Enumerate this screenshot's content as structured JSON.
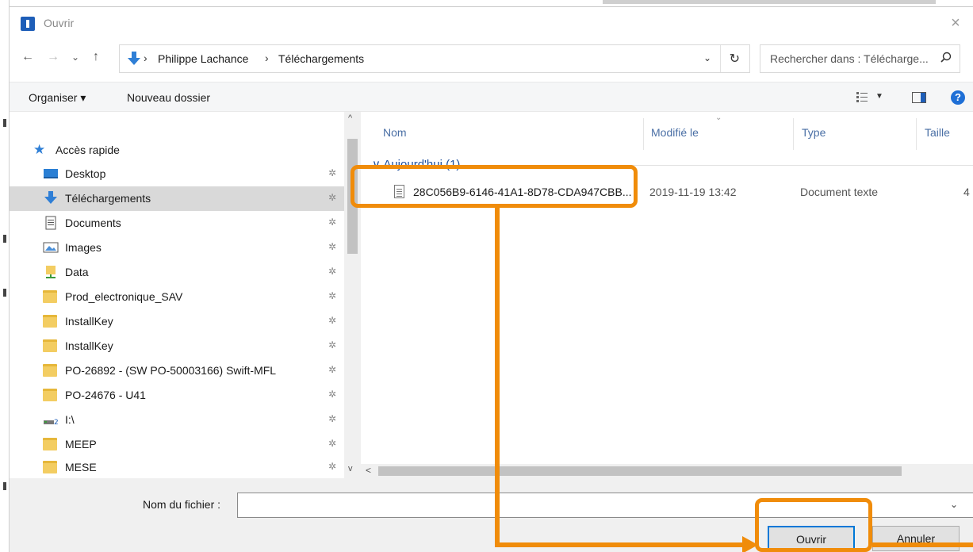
{
  "window": {
    "title": "Ouvrir",
    "close_glyph": "×"
  },
  "nav": {
    "back_glyph": "←",
    "forward_glyph": "→",
    "recent_glyph": "⌄",
    "up_glyph": "↑",
    "breadcrumb": [
      "Philippe Lachance",
      "Téléchargements"
    ],
    "crumb_separator": "›",
    "dropdown_glyph": "⌄",
    "refresh_glyph": "↻"
  },
  "search": {
    "placeholder": "Rechercher dans : Télécharge..."
  },
  "commands": {
    "organize": "Organiser ▾",
    "new_folder": "Nouveau dossier",
    "view_chevron": "▼",
    "help": "?"
  },
  "sidebar": {
    "quick_access": "Accès rapide",
    "pin_glyph": "📌",
    "items": [
      {
        "label": "Desktop",
        "icon": "desktop-icon"
      },
      {
        "label": "Téléchargements",
        "icon": "download-icon",
        "selected": true
      },
      {
        "label": "Documents",
        "icon": "documents-icon"
      },
      {
        "label": "Images",
        "icon": "images-icon"
      },
      {
        "label": "Data",
        "icon": "network-folder-icon"
      },
      {
        "label": "Prod_electronique_SAV",
        "icon": "folder-icon"
      },
      {
        "label": "InstallKey",
        "icon": "folder-icon"
      },
      {
        "label": "InstallKey",
        "icon": "folder-icon"
      },
      {
        "label": "PO-26892 - (SW PO-50003166) Swift-MFL",
        "icon": "folder-icon"
      },
      {
        "label": "PO-24676 - U41",
        "icon": "folder-icon"
      },
      {
        "label": "I:\\",
        "icon": "drive-icon"
      },
      {
        "label": "MEEP",
        "icon": "folder-icon"
      },
      {
        "label": "MESE",
        "icon": "folder-icon"
      }
    ]
  },
  "filelist": {
    "columns": {
      "name": "Nom",
      "modified": "Modifié le",
      "type": "Type",
      "size": "Taille"
    },
    "group": "Aujourd'hui (1)",
    "files": [
      {
        "name": "28C056B9-6146-41A1-8D78-CDA947CBB...",
        "modified": "2019-11-19 13:42",
        "type": "Document texte",
        "size": "4"
      }
    ]
  },
  "bottom": {
    "filename_label": "Nom du fichier :",
    "filename_value": "",
    "open_label": "Ouvrir",
    "cancel_label": "Annuler"
  },
  "colors": {
    "annotation": "#f08c0a",
    "accent": "#0078d7",
    "selected": "#d9d9d9"
  }
}
